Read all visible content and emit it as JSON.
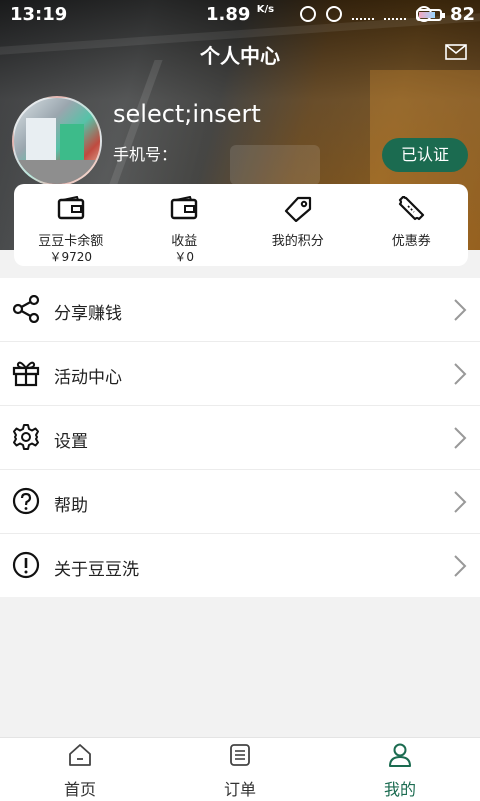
{
  "status_bar": {
    "time": "13:19",
    "speed": "1.89",
    "speed_unit": "K/s",
    "battery": "82",
    "battery_level": 0.82
  },
  "header": {
    "title": "个人中心",
    "mail_icon": "mail-icon"
  },
  "profile": {
    "username": "select;insert",
    "phone_label": "手机号：",
    "verified_label": "已认证"
  },
  "stats": [
    {
      "label": "豆豆卡余额",
      "value": "￥9720",
      "icon": "wallet-icon"
    },
    {
      "label": "收益",
      "value": "￥0",
      "icon": "wallet-icon"
    },
    {
      "label": "我的积分",
      "value": "",
      "icon": "tag-icon"
    },
    {
      "label": "优惠券",
      "value": "",
      "icon": "ticket-icon"
    }
  ],
  "menu": [
    {
      "label": "分享赚钱",
      "icon": "share-icon"
    },
    {
      "label": "活动中心",
      "icon": "gift-icon"
    },
    {
      "label": "设置",
      "icon": "gear-icon"
    },
    {
      "label": "帮助",
      "icon": "help-icon"
    },
    {
      "label": "关于豆豆洗",
      "icon": "info-icon"
    }
  ],
  "bottom_nav": [
    {
      "label": "首页",
      "icon": "home-icon",
      "active": false
    },
    {
      "label": "订单",
      "icon": "orders-icon",
      "active": false
    },
    {
      "label": "我的",
      "icon": "user-icon",
      "active": true
    }
  ],
  "colors": {
    "accent": "#1b6b50",
    "background": "#f2f2f2"
  }
}
